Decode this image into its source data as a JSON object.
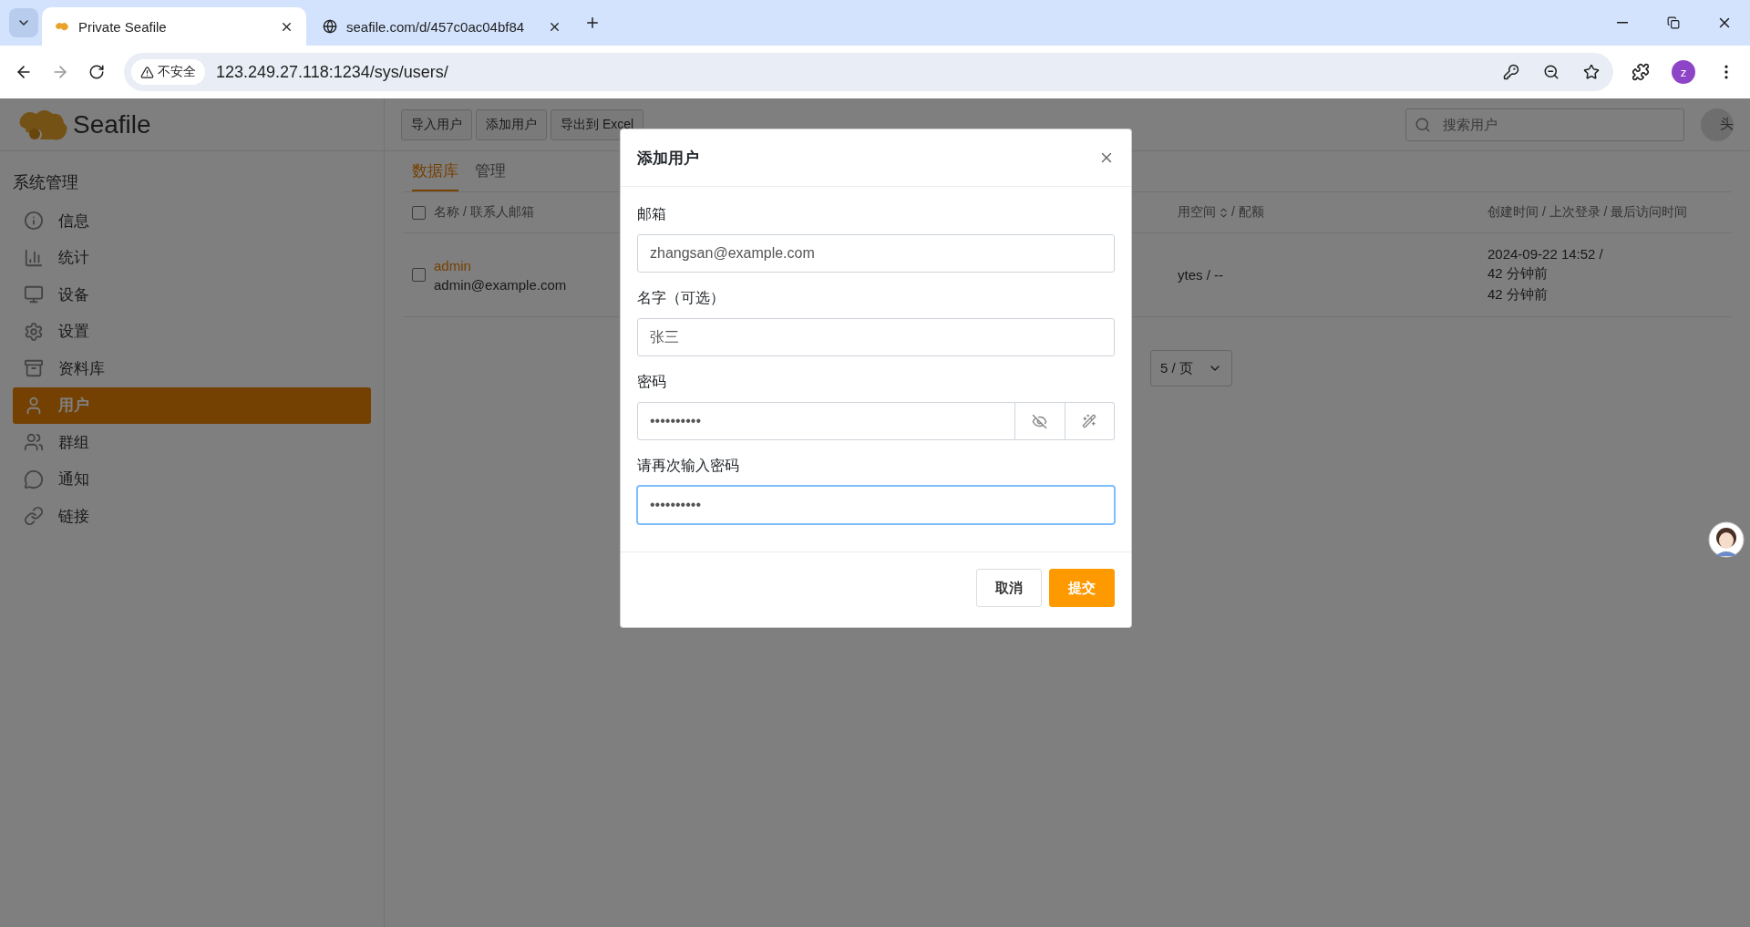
{
  "browser": {
    "tabs": [
      {
        "title": "Private Seafile",
        "selected": true
      },
      {
        "title": "seafile.com/d/457c0ac04bf84",
        "selected": false
      }
    ],
    "security_label": "不安全",
    "url": "123.249.27.118:1234/sys/users/",
    "profile_initial": "z"
  },
  "header": {
    "logo_text": "Seafile",
    "toolbar_buttons": [
      "导入用户",
      "添加用户",
      "导出到 Excel"
    ],
    "search": {
      "placeholder": "搜索用户"
    },
    "avatar_alt": "头"
  },
  "sidebar": {
    "heading": "系统管理",
    "items": [
      {
        "label": "信息",
        "selected": false
      },
      {
        "label": "统计",
        "selected": false
      },
      {
        "label": "设备",
        "selected": false
      },
      {
        "label": "设置",
        "selected": false
      },
      {
        "label": "资料库",
        "selected": false
      },
      {
        "label": "用户",
        "selected": true
      },
      {
        "label": "群组",
        "selected": false
      },
      {
        "label": "通知",
        "selected": false
      },
      {
        "label": "链接",
        "selected": false
      }
    ]
  },
  "tabs": [
    {
      "label": "数据库",
      "selected": true
    },
    {
      "label": "管理",
      "selected": false
    }
  ],
  "table": {
    "all_checked": false,
    "columns": [
      {
        "label": "名称 / 联系人邮箱"
      },
      {
        "label": "用空间",
        "sortable": true,
        "suffix": "/ 配额"
      },
      {
        "label": "创建时间 / 上次登录 / 最后访问时间"
      }
    ],
    "rows": [
      {
        "checked": false,
        "name": "admin",
        "email": "admin@example.com",
        "column_2": "ytes / --",
        "times": [
          "2024-09-22 14:52 /",
          "42 分钟前",
          "42 分钟前"
        ]
      }
    ]
  },
  "pagination": {
    "per_page": "5 / 页"
  },
  "dialog": {
    "title": "添加用户",
    "fields": [
      {
        "kind": "text",
        "label": "邮箱",
        "value": "zhangsan@example.com",
        "focused": false
      },
      {
        "kind": "text",
        "label": "名字（可选）",
        "value": "张三",
        "focused": false
      },
      {
        "kind": "password",
        "label": "密码",
        "value": "••••••••••",
        "focused": false
      },
      {
        "kind": "text",
        "label": "请再次输入密码",
        "value": "••••••••••",
        "focused": true
      }
    ],
    "buttons": [
      {
        "label": "取消",
        "kind": "secondary"
      },
      {
        "label": "提交",
        "kind": "primary"
      }
    ]
  }
}
